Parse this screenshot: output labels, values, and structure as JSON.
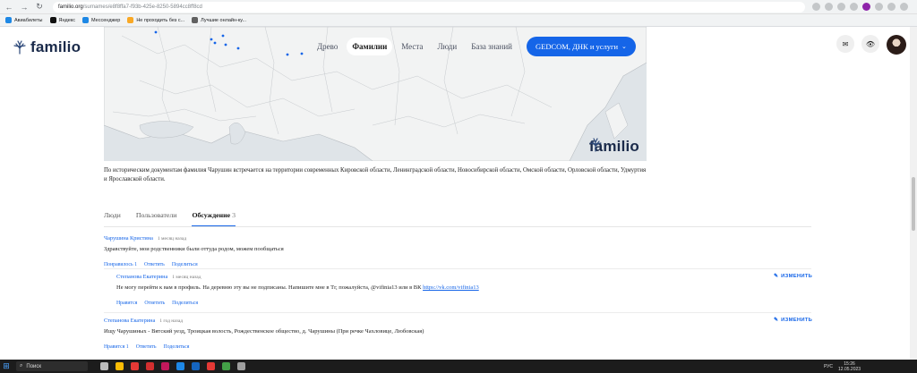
{
  "browser": {
    "url_host": "familio.org",
    "url_path": "/surnames/e8f8ffa7-f93b-425e-8250-5894cc8ff8cd"
  },
  "bookmarks": [
    {
      "label": "Авиабилеты",
      "color": "#1e88e5"
    },
    {
      "label": "Яндекс",
      "color": "#111111"
    },
    {
      "label": "Мессенджер",
      "color": "#1e88e5"
    },
    {
      "label": "Не проходить без с...",
      "color": "#f9a825"
    },
    {
      "label": "Лучшие онлайн-ку...",
      "color": "#616161"
    }
  ],
  "site": {
    "logo": "familio",
    "nav": [
      {
        "label": "Древо",
        "active": false
      },
      {
        "label": "Фамилии",
        "active": true
      },
      {
        "label": "Места",
        "active": false
      },
      {
        "label": "Люди",
        "active": false
      },
      {
        "label": "База знаний",
        "active": false
      }
    ],
    "gedcom_button": "GEDCOM, ДНК и услуги",
    "accent_color": "#1565e8"
  },
  "map": {
    "watermark": "familio"
  },
  "description": "По историческим документам фамилия Чарушин встречается на территории современных Кировской области, Ленинградской области, Новосибирской области, Омской области, Орловской области, Удмуртия и Ярославской области.",
  "tabs": [
    {
      "label": "Люди",
      "count": "",
      "active": false
    },
    {
      "label": "Пользователи",
      "count": "",
      "active": false
    },
    {
      "label": "Обсуждение",
      "count": "3",
      "active": true
    }
  ],
  "comments": [
    {
      "author": "Чарушина Кристина",
      "time": "1 месяц назад",
      "text": "Здравствуйте, мои родственники были оттуда родом, можем пообщаться",
      "actions": {
        "like": "Понравилось 1",
        "reply": "Ответить",
        "share": "Поделиться"
      }
    },
    {
      "author": "Степанова Екатерина",
      "time": "1 месяц назад",
      "text": "Не могу перейти к вам в профиль. На деревню эту вы не подписаны. Напишите мне в Тг, пожалуйста, @vifinia13 или в ВК ",
      "link": "https://vk.com/vifinia13",
      "edit": "ИЗМЕНИТЬ",
      "actions": {
        "like": "Нравится",
        "reply": "Ответить",
        "share": "Поделиться"
      }
    },
    {
      "author": "Степанова Екатерина",
      "time": "1 год назад",
      "text": "Ищу Чарушиных - Вятский уезд, Троицкая волость, Рождественское общество, д. Чарушины (При речке Чахловице, Любовская)",
      "edit": "ИЗМЕНИТЬ",
      "actions": {
        "like": "Нравится 1",
        "reply": "Ответить",
        "share": "Поделиться"
      }
    }
  ],
  "taskbar": {
    "search": "Поиск",
    "lang": "РУС",
    "time": "15:26",
    "date": "12.05.2023"
  }
}
